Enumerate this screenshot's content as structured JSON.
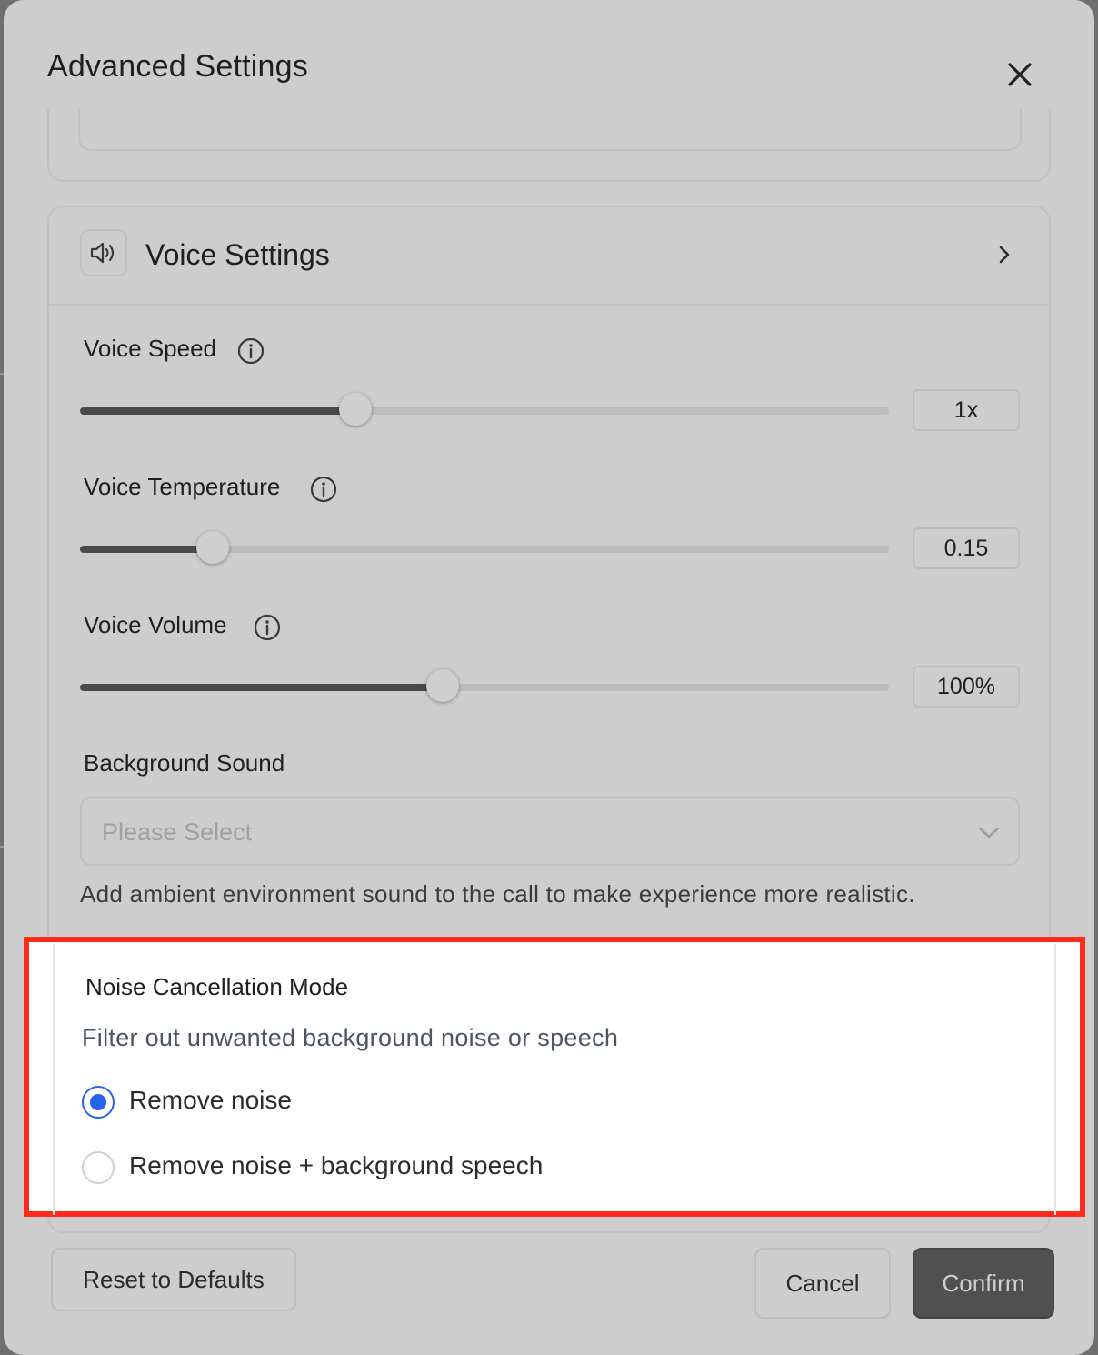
{
  "dialog": {
    "title": "Advanced Settings"
  },
  "voice_settings": {
    "title": "Voice Settings",
    "voice_speed": {
      "label": "Voice Speed",
      "value_text": "1x",
      "fill_fraction": 0.34
    },
    "voice_temperature": {
      "label": "Voice Temperature",
      "value_text": "0.15",
      "fill_fraction": 0.164
    },
    "voice_volume": {
      "label": "Voice Volume",
      "value_text": "100%",
      "fill_fraction": 0.448
    },
    "background_sound": {
      "label": "Background Sound",
      "placeholder": "Please Select",
      "helper": "Add ambient environment sound to the call to make experience more realistic."
    }
  },
  "noise_cancellation": {
    "title": "Noise Cancellation Mode",
    "description": "Filter out unwanted background noise or speech",
    "options": [
      {
        "label": "Remove noise",
        "selected": true
      },
      {
        "label": "Remove noise + background speech",
        "selected": false
      }
    ],
    "highlight_color": "#ff2a1a",
    "radio_color": "#2563eb"
  },
  "footer": {
    "reset_label": "Reset to Defaults",
    "cancel_label": "Cancel",
    "confirm_label": "Confirm"
  },
  "icons": {
    "close": "close-icon",
    "speaker": "speaker-icon",
    "expand": "chevron-right-icon",
    "info": "info-icon",
    "dropdown": "chevron-down-icon"
  }
}
